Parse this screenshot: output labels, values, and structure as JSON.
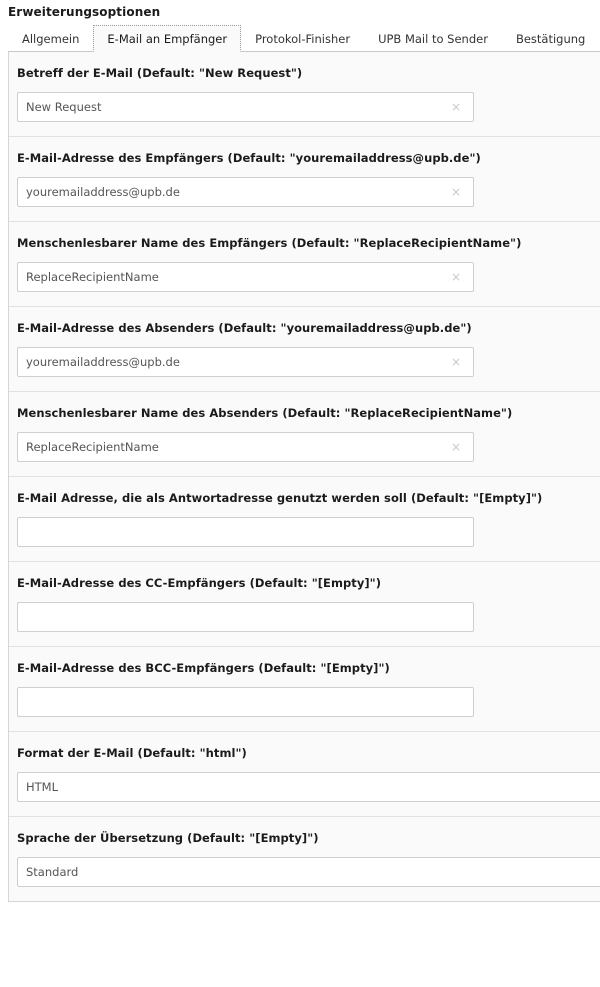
{
  "panel": {
    "title": "Erweiterungsoptionen"
  },
  "tabs": [
    {
      "label": "Allgemein",
      "active": false
    },
    {
      "label": "E-Mail an Empfänger",
      "active": true
    },
    {
      "label": "Protokol-Finisher",
      "active": false
    },
    {
      "label": "UPB Mail to Sender",
      "active": false
    },
    {
      "label": "Bestätigung",
      "active": false
    }
  ],
  "icons": {
    "clear": "×"
  },
  "fields": [
    {
      "label": "Betreff der E-Mail (Default: \"New Request\")",
      "value": "New Request",
      "placeholder": "",
      "type": "text",
      "clearable": true
    },
    {
      "label": "E-Mail-Adresse des Empfängers (Default: \"youremailaddress@upb.de\")",
      "value": "youremailaddress@upb.de",
      "placeholder": "",
      "type": "text",
      "clearable": true
    },
    {
      "label": "Menschenlesbarer Name des Empfängers (Default: \"ReplaceRecipientName\")",
      "value": "ReplaceRecipientName",
      "placeholder": "",
      "type": "text",
      "clearable": true
    },
    {
      "label": "E-Mail-Adresse des Absenders (Default: \"youremailaddress@upb.de\")",
      "value": "youremailaddress@upb.de",
      "placeholder": "",
      "type": "text",
      "clearable": true
    },
    {
      "label": "Menschenlesbarer Name des Absenders (Default: \"ReplaceRecipientName\")",
      "value": "ReplaceRecipientName",
      "placeholder": "",
      "type": "text",
      "clearable": true
    },
    {
      "label": "E-Mail Adresse, die als Antwortadresse genutzt werden soll (Default: \"[Empty]\")",
      "value": "",
      "placeholder": "",
      "type": "text",
      "clearable": false
    },
    {
      "label": "E-Mail-Adresse des CC-Empfängers (Default: \"[Empty]\")",
      "value": "",
      "placeholder": "",
      "type": "text",
      "clearable": false
    },
    {
      "label": "E-Mail-Adresse des BCC-Empfängers (Default: \"[Empty]\")",
      "value": "",
      "placeholder": "",
      "type": "text",
      "clearable": false
    },
    {
      "label": "Format der E-Mail (Default: \"html\")",
      "value": "HTML",
      "placeholder": "",
      "type": "select",
      "clearable": false
    },
    {
      "label": "Sprache der Übersetzung (Default: \"[Empty]\")",
      "value": "Standard",
      "placeholder": "",
      "type": "select",
      "clearable": false
    }
  ]
}
